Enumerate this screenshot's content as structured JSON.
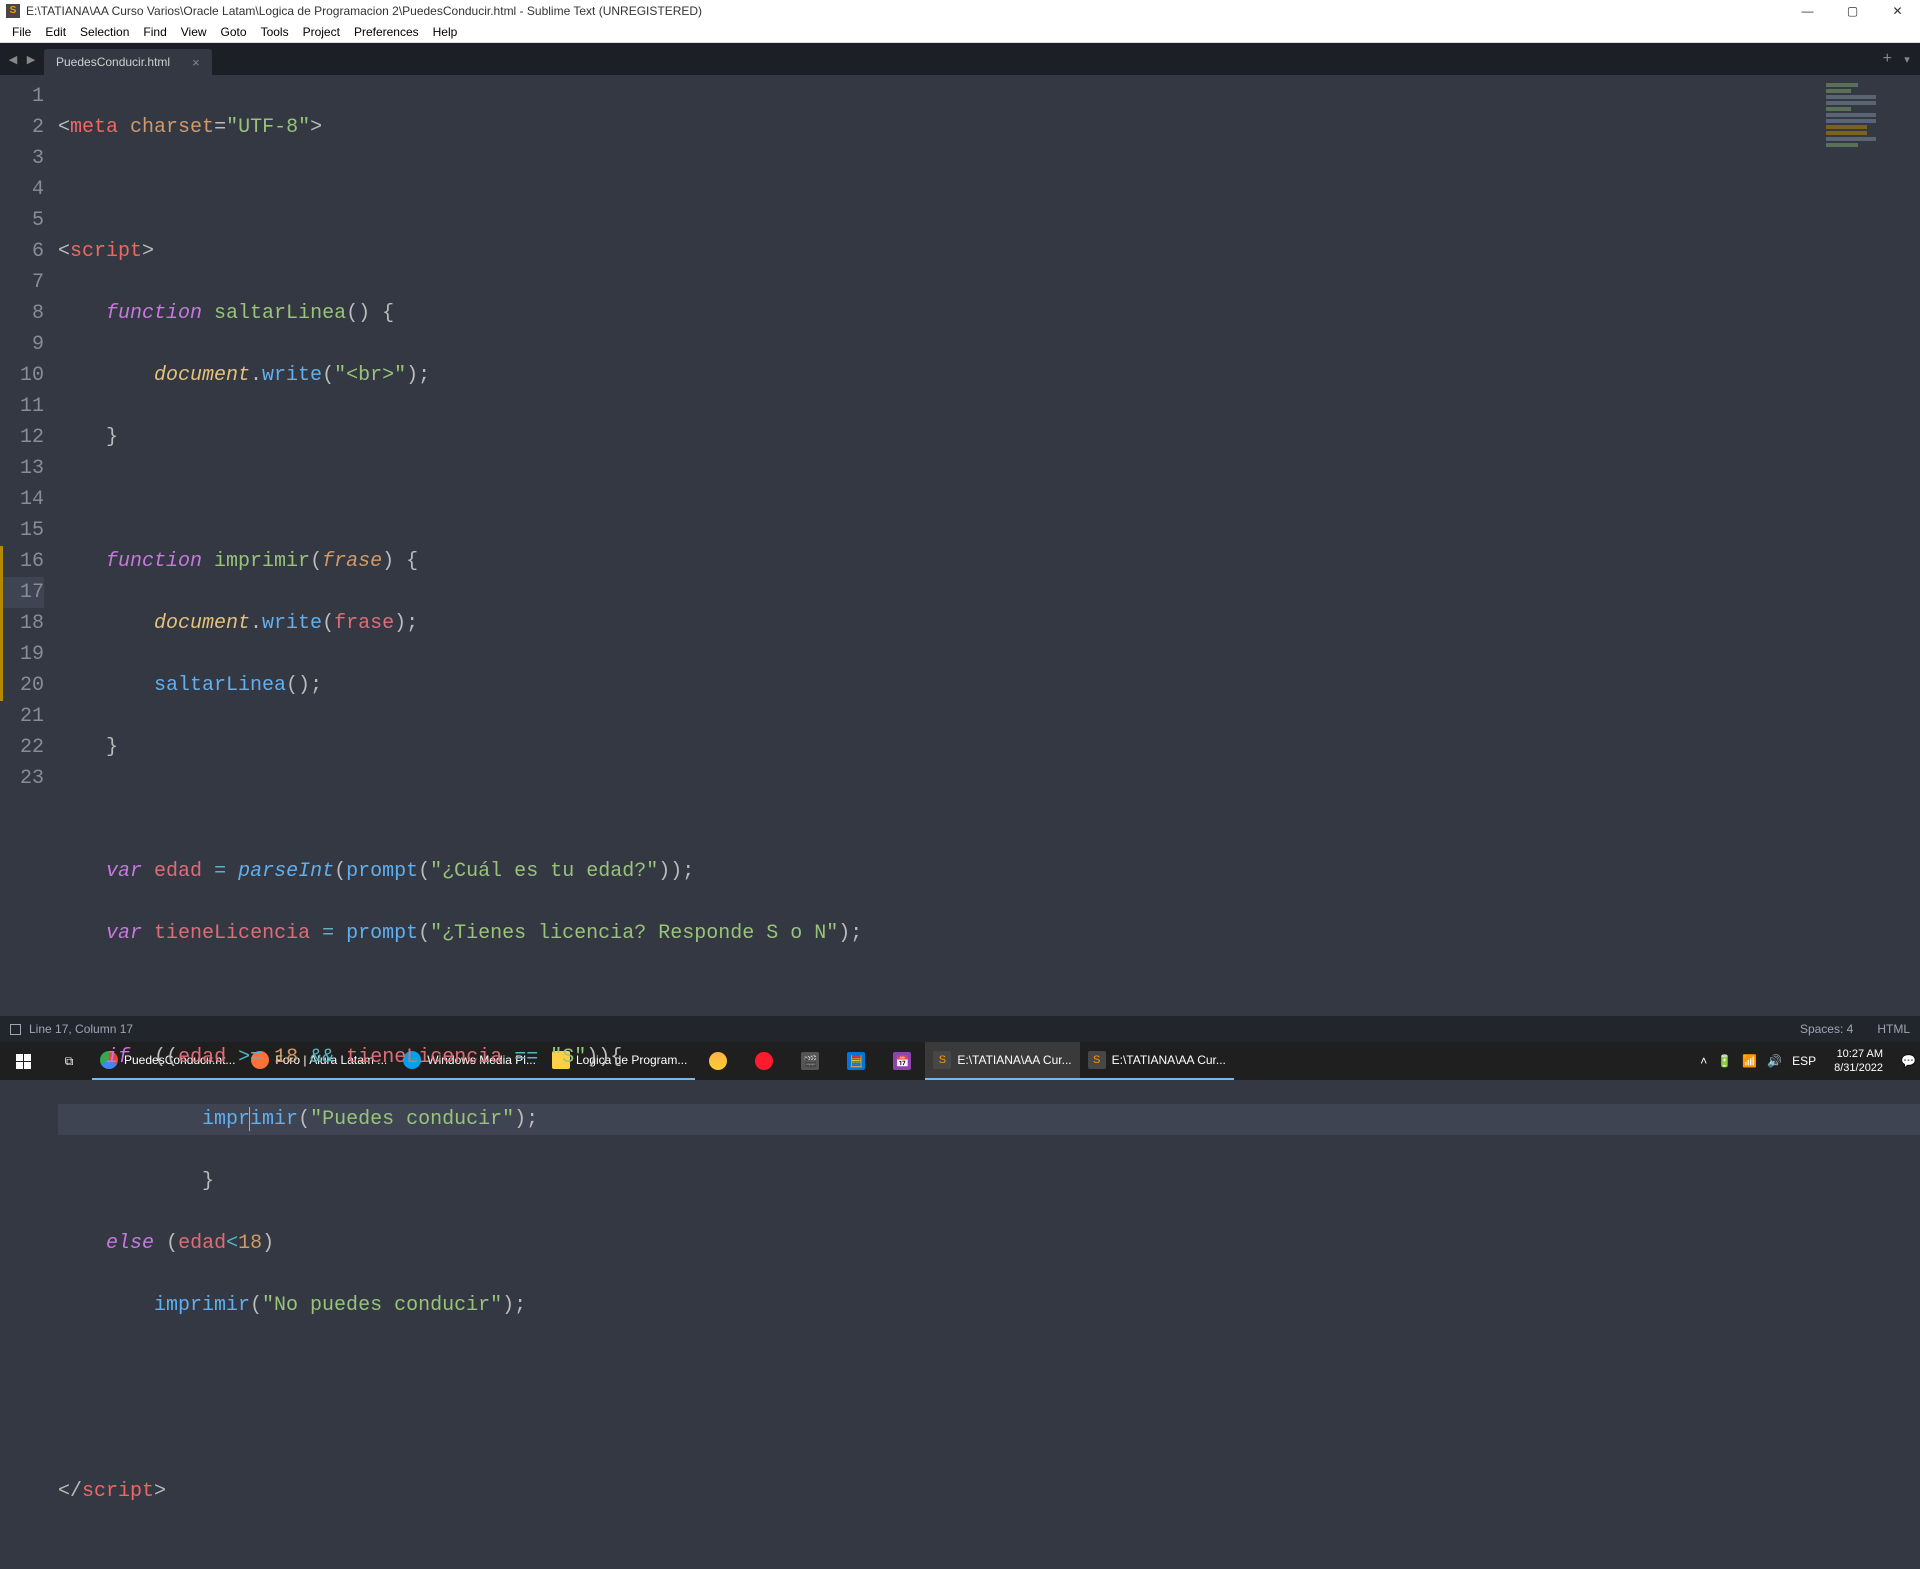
{
  "window": {
    "title": "E:\\TATIANA\\AA Curso Varios\\Oracle Latam\\Logica de Programacion 2\\PuedesConducir.html - Sublime Text (UNREGISTERED)",
    "min": "—",
    "max": "▢",
    "close": "✕"
  },
  "menu": [
    "File",
    "Edit",
    "Selection",
    "Find",
    "View",
    "Goto",
    "Tools",
    "Project",
    "Preferences",
    "Help"
  ],
  "tab": {
    "name": "PuedesConducir.html",
    "close": "×"
  },
  "gutter_lines": [
    "1",
    "2",
    "3",
    "4",
    "5",
    "6",
    "7",
    "8",
    "9",
    "10",
    "11",
    "12",
    "13",
    "14",
    "15",
    "16",
    "17",
    "18",
    "19",
    "20",
    "21",
    "22",
    "23"
  ],
  "statusbar": {
    "position": "Line 17, Column 17",
    "spaces": "Spaces: 4",
    "syntax": "HTML"
  },
  "code": {
    "l1": {
      "a": "<",
      "b": "meta",
      "sp": " ",
      "c": "charset",
      "eq": "=",
      "d": "\"UTF-8\"",
      "e": ">"
    },
    "l3": {
      "a": "<",
      "b": "script",
      "c": ">"
    },
    "l4": {
      "a": "function",
      "sp": " ",
      "b": "saltarLinea",
      "c": "()",
      "sp2": " ",
      "d": "{"
    },
    "l5": {
      "a": "document",
      "b": ".",
      "c": "write",
      "d": "(",
      "e": "\"<br>\"",
      "f": ")",
      "g": ";"
    },
    "l6": {
      "a": "}"
    },
    "l8": {
      "a": "function",
      "sp": " ",
      "b": "imprimir",
      "c": "(",
      "d": "frase",
      "e": ")",
      "sp2": " ",
      "f": "{"
    },
    "l9": {
      "a": "document",
      "b": ".",
      "c": "write",
      "d": "(",
      "e": "frase",
      "f": ")",
      "g": ";"
    },
    "l10": {
      "a": "saltarLinea",
      "b": "()",
      "c": ";"
    },
    "l11": {
      "a": "}"
    },
    "l13": {
      "a": "var",
      "sp": " ",
      "b": "edad",
      "sp2": " ",
      "c": "=",
      "sp3": " ",
      "d": "parseInt",
      "e": "(",
      "f": "prompt",
      "g": "(",
      "h": "\"¿Cuál es tu edad?\"",
      "i": ")",
      "j": ")",
      "k": ";"
    },
    "l14": {
      "a": "var",
      "sp": " ",
      "b": "tieneLicencia",
      "sp2": " ",
      "c": "=",
      "sp3": " ",
      "d": "prompt",
      "e": "(",
      "f": "\"¿Tienes licencia? Responde S o N\"",
      "g": ")",
      "h": ";"
    },
    "l16": {
      "a": "if",
      "sp": "  ",
      "b": "((",
      "c": "edad",
      "sp2": " ",
      "d": ">=",
      "sp3": " ",
      "e": "18",
      "sp4": " ",
      "f": "&&",
      "sp5": " ",
      "g": "tieneLicencia",
      "sp6": " ",
      "h": "==",
      "sp7": " ",
      "i": "\"S\"",
      "j": "))",
      "k": "{"
    },
    "l17": {
      "a": "impr",
      "b": "imir",
      "c": "(",
      "d": "\"Puedes conducir\"",
      "e": ")",
      "f": ";"
    },
    "l18": {
      "a": "}"
    },
    "l19": {
      "a": "else",
      "sp": " ",
      "b": "(",
      "c": "edad",
      "d": "<",
      "e": "18",
      "f": ")"
    },
    "l20": {
      "a": "imprimir",
      "b": "(",
      "c": "\"No puedes conducir\"",
      "d": ")",
      "e": ";"
    },
    "l23": {
      "a": "</",
      "b": "script",
      "c": ">"
    }
  },
  "taskbar": {
    "apps": [
      {
        "label": "PuedesConducir.ht...",
        "color": "#1ba1e2",
        "letter": ""
      },
      {
        "label": "Foro | Alura Latam ...",
        "color": "#ff7139",
        "letter": ""
      },
      {
        "label": "Windows Media Pl...",
        "color": "#00a2ed",
        "letter": ""
      },
      {
        "label": "Logica de Program...",
        "color": "#ffcf48",
        "letter": ""
      }
    ],
    "icon_only": [
      {
        "color": "#ff3b3b"
      },
      {
        "color": "#ffffff"
      },
      {
        "color": "#0078d7"
      },
      {
        "color": "#8e44ad"
      }
    ],
    "active_apps": [
      {
        "label": "E:\\TATIANA\\AA Cur...",
        "color": "#474747",
        "accent": "#ff9800"
      },
      {
        "label": "E:\\TATIANA\\AA Cur...",
        "color": "#474747",
        "accent": "#ff9800"
      }
    ],
    "tray": {
      "lang": "ESP",
      "time": "10:27 AM",
      "date": "8/31/2022"
    }
  }
}
